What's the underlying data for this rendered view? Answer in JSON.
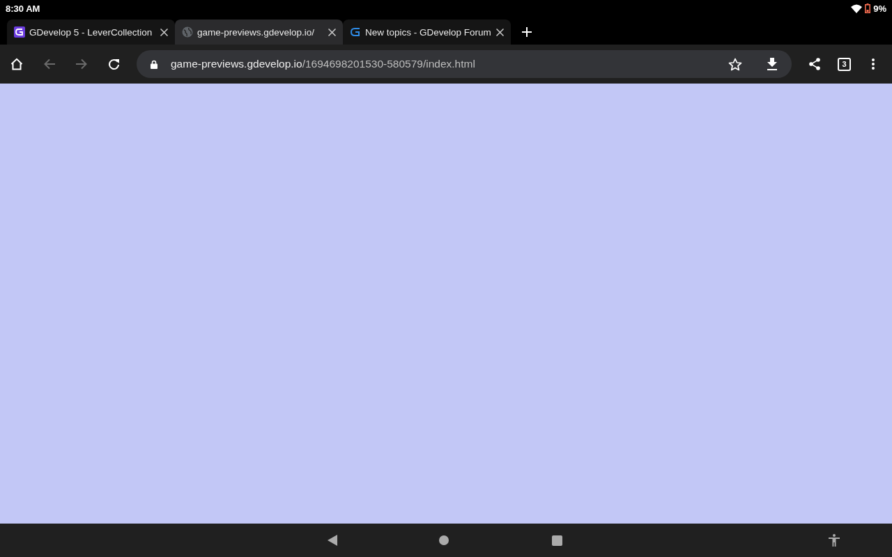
{
  "status_bar": {
    "time": "8:30 AM",
    "battery": "9%"
  },
  "tabs": [
    {
      "title": "GDevelop 5 - LeverCollection",
      "kind": "app",
      "selected": false
    },
    {
      "title": "game-previews.gdevelop.io/",
      "kind": "site",
      "selected": true
    },
    {
      "title": "New topics - GDevelop Forum",
      "kind": "forum",
      "selected": false
    }
  ],
  "toolbar": {
    "url_host": "game-previews.gdevelop.io",
    "url_path": "/1694698201530-580579/index.html",
    "tab_count": "3",
    "back_disabled": true,
    "forward_disabled": true
  }
}
